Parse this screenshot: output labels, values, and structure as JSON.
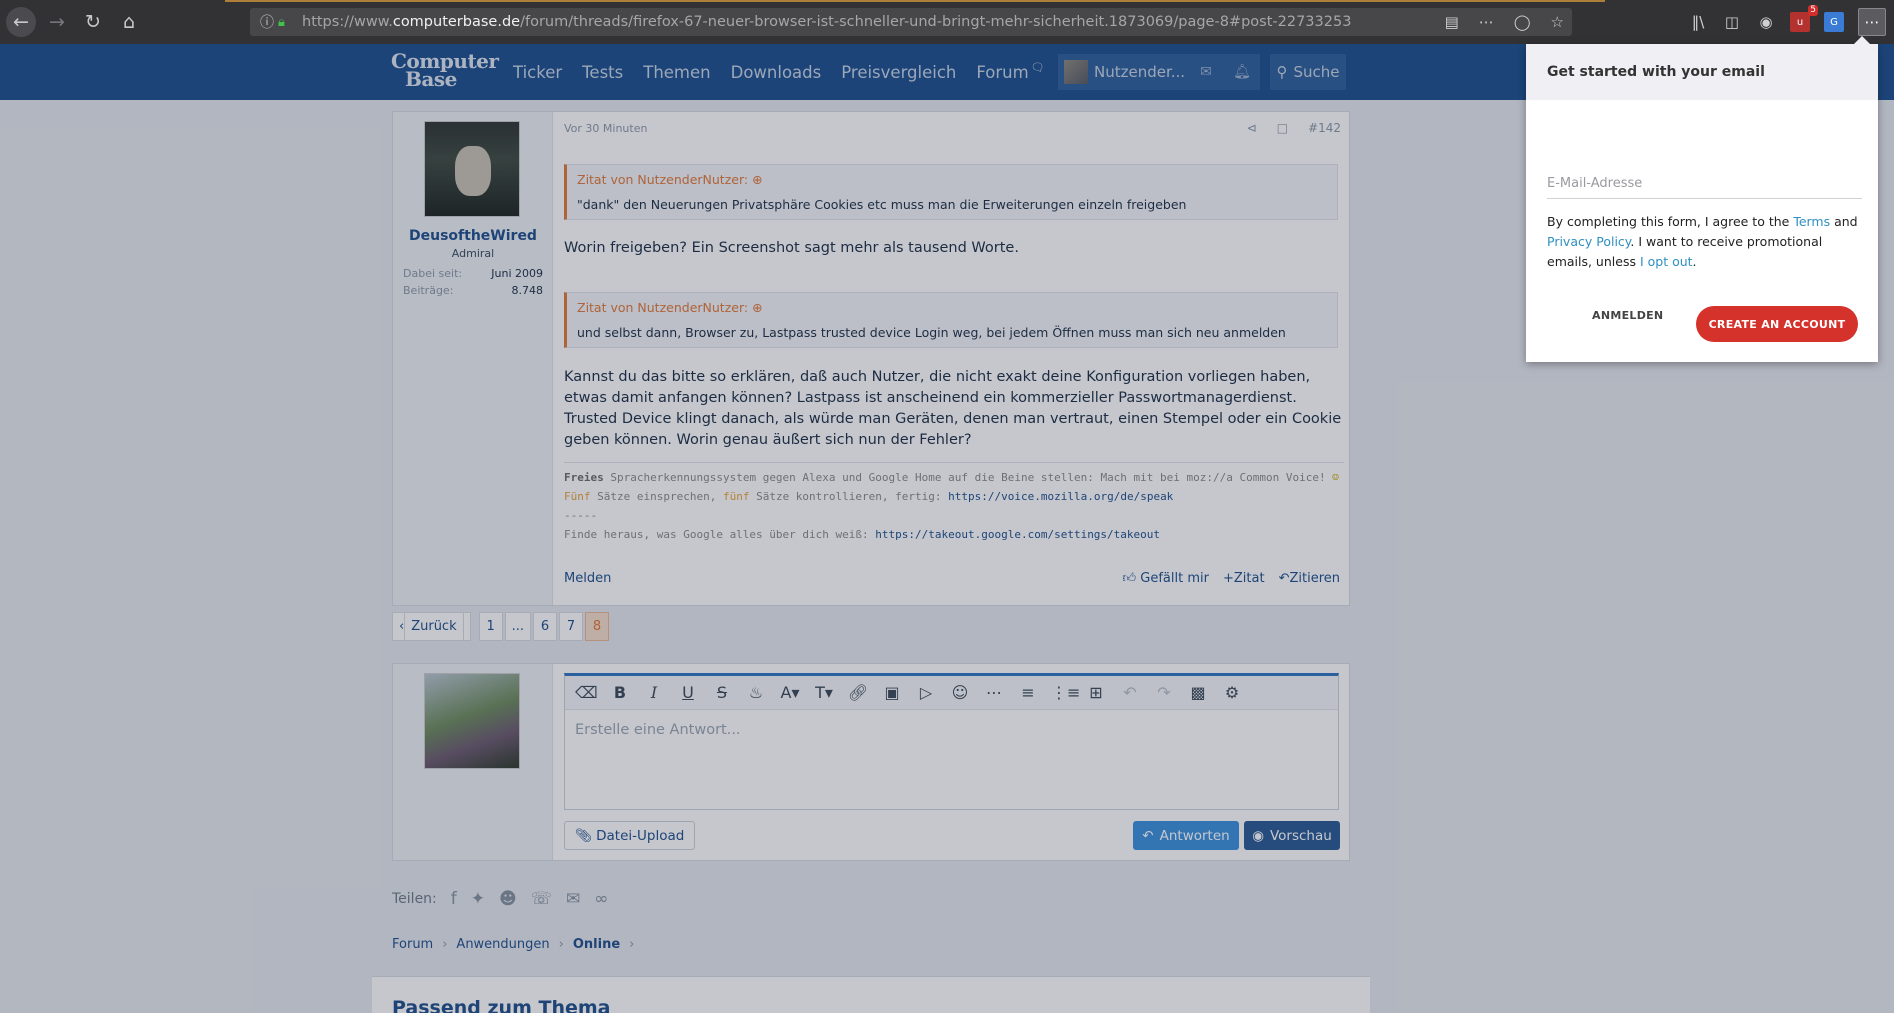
{
  "browser": {
    "url_prefix": "https://www.",
    "url_domain": "computerbase.de",
    "url_path": "/forum/threads/firefox-67-neuer-browser-ist-schneller-und-bringt-mehr-sicherheit.1873069/page-8#post-22733253",
    "ext_badge": "5",
    "icons": [
      "back-icon",
      "forward-icon",
      "reload-icon",
      "home-icon",
      "info-icon",
      "lock-icon",
      "reader-icon",
      "more-icon",
      "pocket-icon",
      "bookmark-star-icon",
      "library-icon",
      "sidebar-icon",
      "extension-icons"
    ]
  },
  "site": {
    "logo_line1": "Computer",
    "logo_line2": "Base",
    "nav": [
      "Ticker",
      "Tests",
      "Themen",
      "Downloads",
      "Preisvergleich",
      "Forum"
    ],
    "user": "Nutzender...",
    "search": "Suche"
  },
  "post": {
    "author": "DeusoftheWired",
    "rank": "Admiral",
    "stats": [
      {
        "label": "Dabei seit:",
        "value": "Juni 2009"
      },
      {
        "label": "Beiträge:",
        "value": "8.748"
      }
    ],
    "time": "Vor 30 Minuten",
    "number": "#142",
    "quote1_head": "Zitat von NutzenderNutzer:",
    "quote1_body": "\"dank\" den Neuerungen Privatsphäre Cookies etc muss man die Erweiterungen einzeln freigeben",
    "text1": "Worin freigeben? Ein Screenshot sagt mehr als tausend Worte.",
    "quote2_head": "Zitat von NutzenderNutzer:",
    "quote2_body": "und selbst dann, Browser zu, Lastpass trusted device Login weg, bei jedem Öffnen muss man sich neu anmelden",
    "text2": "Kannst du das bitte so erklären, daß auch Nutzer, die nicht exakt deine Konfiguration vorliegen haben, etwas damit anfangen können? Lastpass ist anscheinend ein kommerzieller Passwortmanagerdienst. Trusted Device klingt danach, als würde man Geräten, denen man vertraut, einen Stempel oder ein Cookie geben können. Worin genau äußert sich nun der Fehler?",
    "sig": {
      "l1_bold": "Freies",
      "l1": " Spracherkennungssystem gegen Alexa und Google Home auf die Beine stellen: Mach mit bei moz://a Common Voice! ",
      "l2_or1": "Fünf",
      "l2_a": " Sätze einsprechen, ",
      "l2_or2": "fünf",
      "l2_b": " Sätze kontrollieren, fertig: ",
      "l2_link": "https://voice.mozilla.org/de/speak",
      "l3": "-----",
      "l4": "Finde heraus, was Google alles über dich weiß: ",
      "l4_link": "https://takeout.google.com/settings/takeout"
    },
    "report": "Melden",
    "like": "Gefällt mir",
    "zitat_plus": "Zitat",
    "quote_btn": "Zitieren"
  },
  "pager": {
    "back": "Zurück",
    "pages": [
      "1",
      "...",
      "6",
      "7",
      "8"
    ],
    "current": "8"
  },
  "reply": {
    "placeholder": "Erstelle eine Antwort...",
    "upload": "Datei-Upload",
    "submit": "Antworten",
    "preview": "Vorschau"
  },
  "share": {
    "label": "Teilen:",
    "icons": [
      "facebook-icon",
      "twitter-icon",
      "reddit-icon",
      "whatsapp-icon",
      "mail-icon",
      "link-icon"
    ]
  },
  "breadcrumb": [
    "Forum",
    "Anwendungen",
    "Online"
  ],
  "related_title": "Passend zum Thema",
  "popup": {
    "title": "Get started with your email",
    "email_placeholder": "E-Mail-Adresse",
    "terms_a": "By completing this form, I agree to the ",
    "terms_link1": "Terms",
    "terms_b": " and ",
    "terms_link2": "Privacy Policy",
    "terms_c": ". I want to receive promotional emails, unless ",
    "terms_link3": "I opt out",
    "terms_d": ".",
    "signin": "ANMELDEN",
    "create": "CREATE AN ACCOUNT"
  },
  "colors": {
    "header_blue": "#1b4f8e",
    "accent_orange": "#e27837",
    "create_red": "#d6322c",
    "link_blue": "#1e4f8c"
  }
}
